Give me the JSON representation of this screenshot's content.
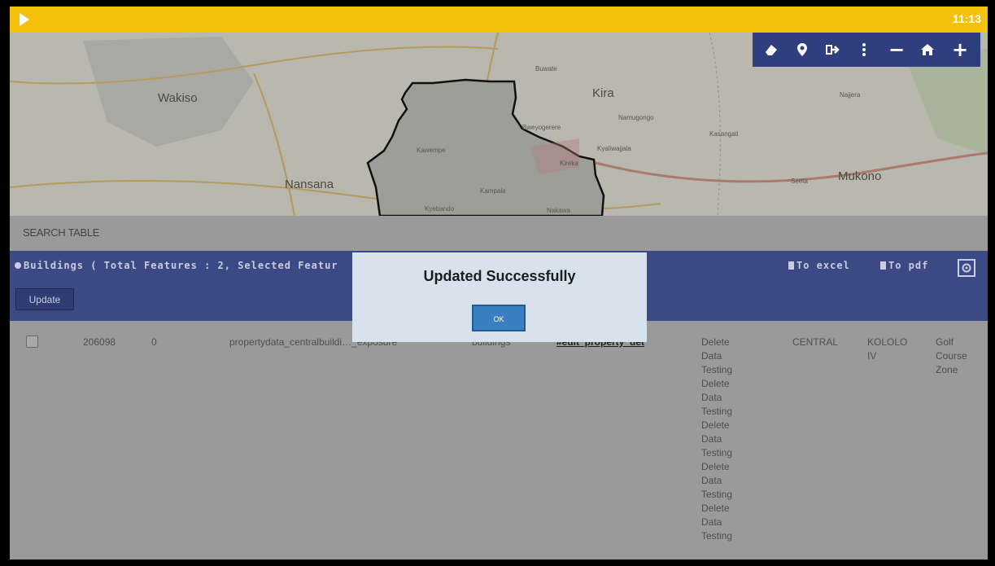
{
  "status_bar": {
    "time": "11:13"
  },
  "map": {
    "places_major": [
      "Wakiso",
      "Kira",
      "Nansana",
      "Mukono"
    ],
    "places_minor": [
      "Buwate",
      "Namugongo",
      "Kyaliwajjala",
      "Bweyogerere",
      "Kawempe",
      "Kampala",
      "Kyebando",
      "Kasangati",
      "Seeta",
      "Kireka",
      "Najjera",
      "Nakawa"
    ]
  },
  "map_toolbar": {
    "icons": [
      "eraser-icon",
      "pin-icon",
      "sign-out-icon",
      "more-vertical-icon",
      "zoom-out-icon",
      "home-icon",
      "zoom-in-icon"
    ],
    "minus": "−",
    "plus": "+"
  },
  "search_table_label": "SEARCH TABLE",
  "layer": {
    "title": "Buildings ( Total Features : 2, Selected Featur",
    "to_excel": "To excel",
    "to_pdf": "To pdf",
    "update_label": "Update"
  },
  "row": {
    "id": "206098",
    "count": "0",
    "path": "propertydata_centralbuildi…_exposure",
    "layer": "buildings",
    "link": "#edit_property_det",
    "notes": [
      "Delete",
      "Data",
      "Testing",
      "Delete",
      "Data",
      "Testing",
      "Delete",
      "Data",
      "Testing",
      "Delete",
      "Data",
      "Testing",
      "Delete",
      "Data",
      "Testing"
    ],
    "region": "CENTRAL",
    "area": [
      "KOLOLO",
      "IV"
    ],
    "zone": [
      "Golf",
      "Course",
      "Zone"
    ]
  },
  "dialog": {
    "title": "Updated Successfully",
    "ok_label": "OK"
  }
}
